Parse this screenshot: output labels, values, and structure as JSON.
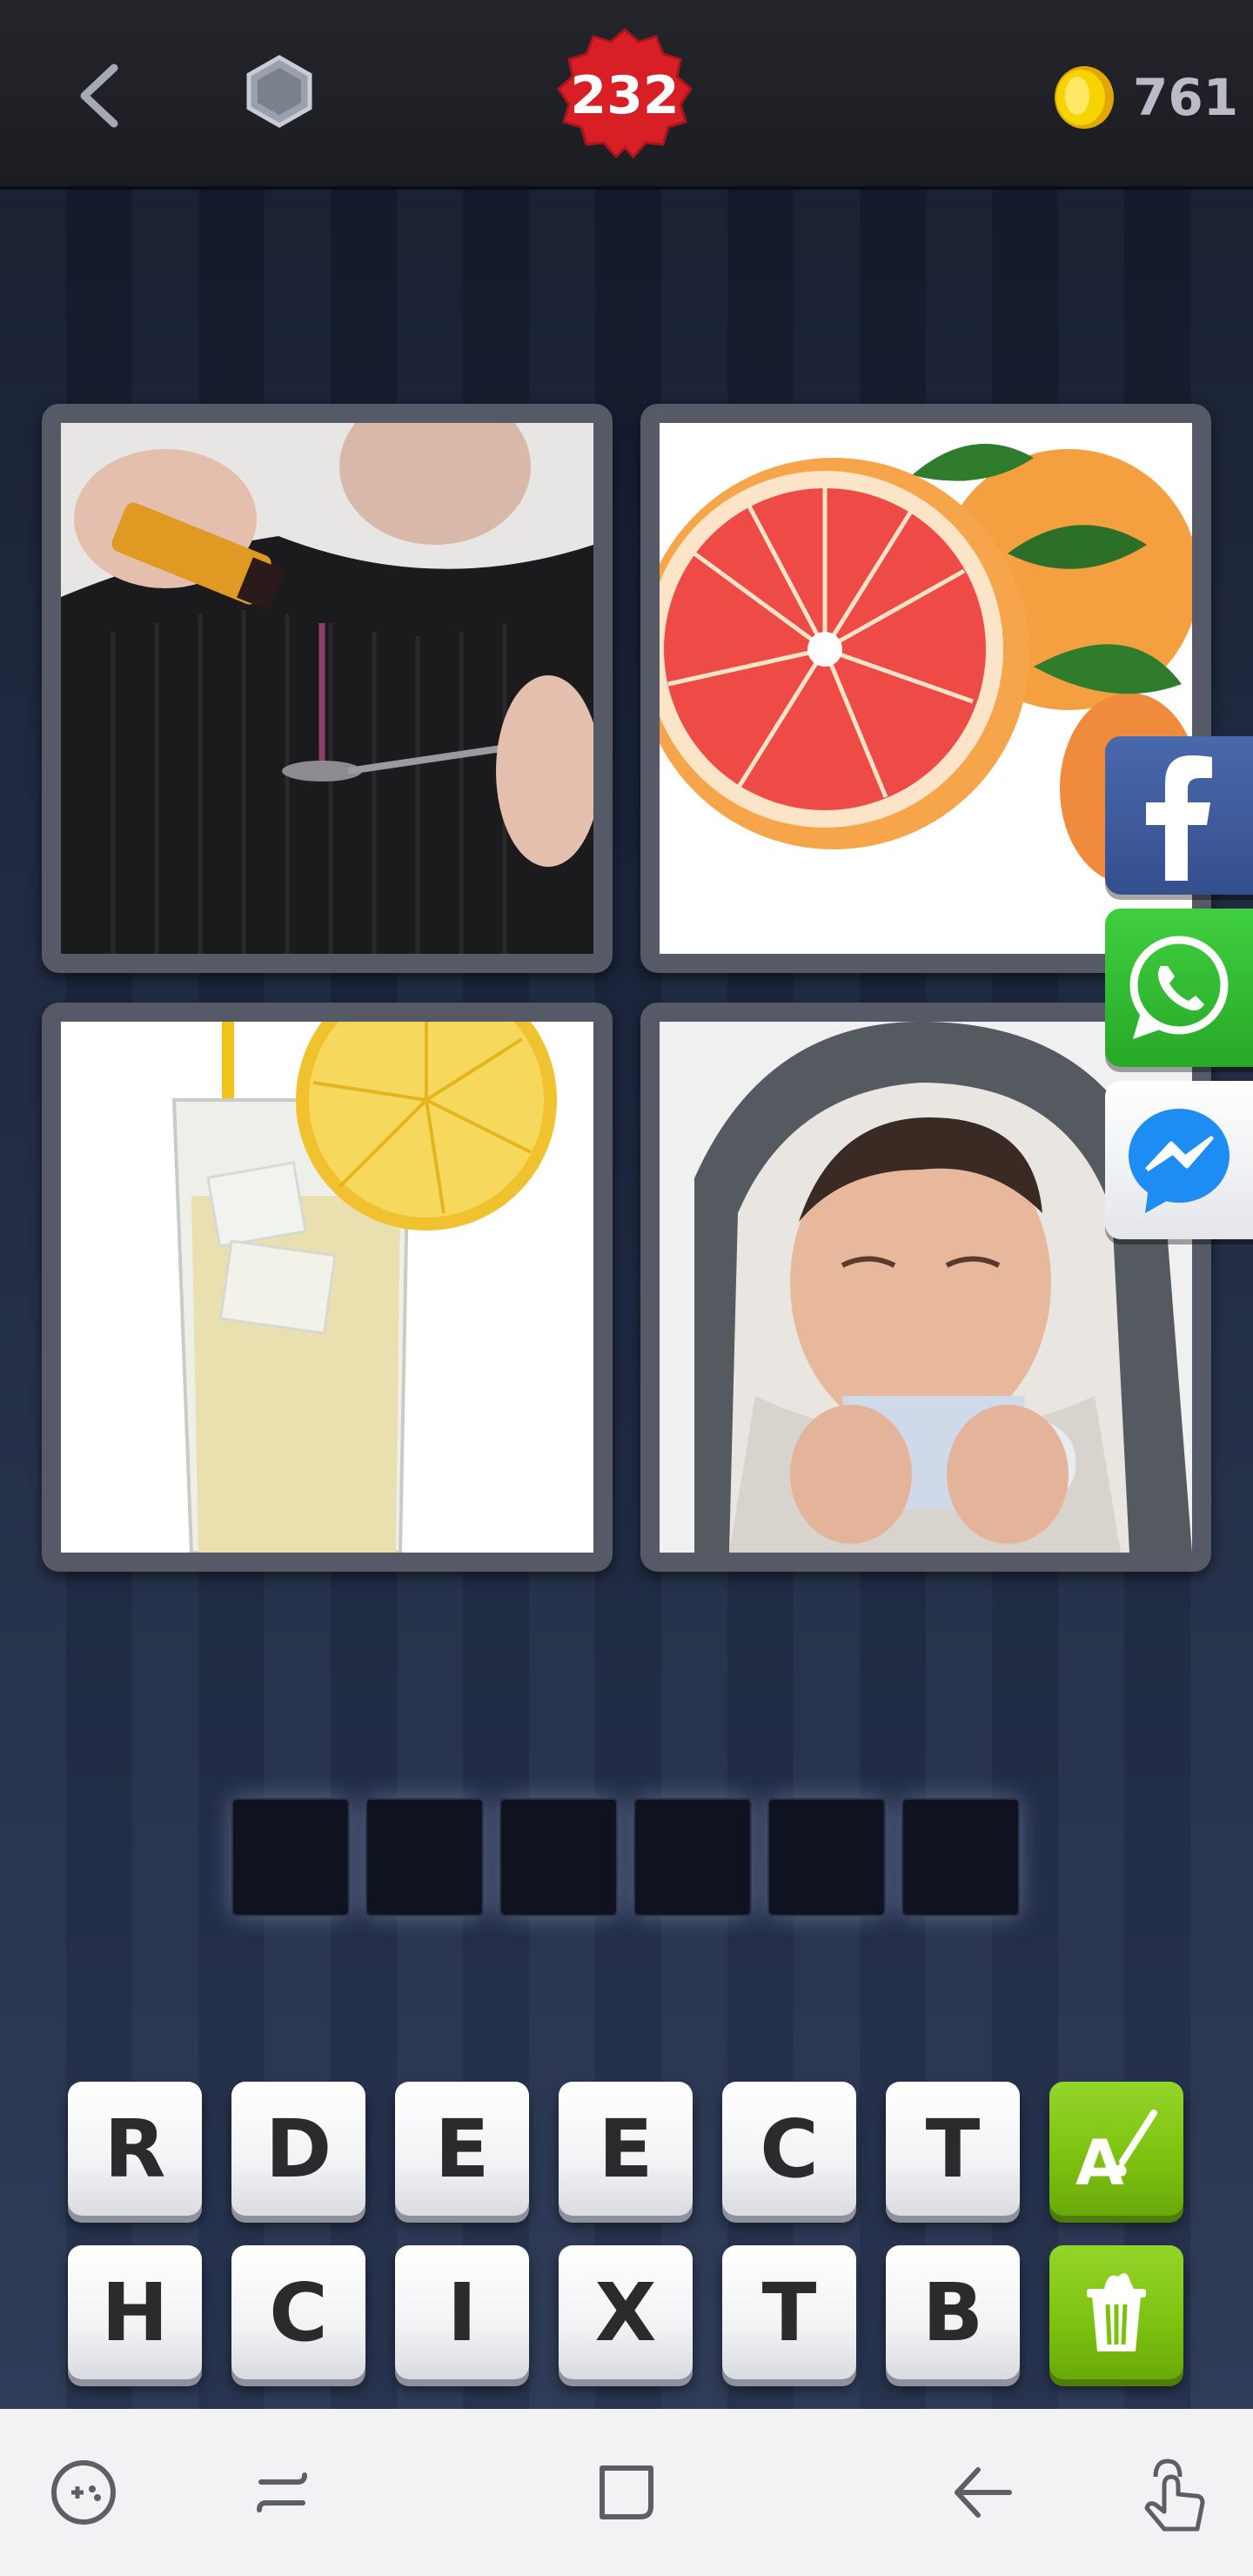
{
  "header": {
    "back_icon": "chevron-left-icon",
    "hint_icon": "hexagon-gem-icon",
    "level": "232",
    "level_badge_color": "#d81f26",
    "coins": "761",
    "coin_color": "#f2c200"
  },
  "pictures": [
    {
      "name": "man-pouring-syrup-on-spoon"
    },
    {
      "name": "grapefruit-halves"
    },
    {
      "name": "lemonade-glass-with-lemon-slice"
    },
    {
      "name": "woman-in-hood-drinking-from-mug"
    }
  ],
  "share": {
    "facebook_color": "#3b5998",
    "whatsapp_color": "#2fbd2f",
    "messenger_color": "#ffffff"
  },
  "answer": {
    "slots": [
      "",
      "",
      "",
      "",
      "",
      ""
    ]
  },
  "letters": {
    "row1": [
      "R",
      "D",
      "E",
      "E",
      "C",
      "T"
    ],
    "row2": [
      "H",
      "C",
      "I",
      "X",
      "T",
      "B"
    ]
  },
  "hint_buttons": {
    "reveal_icon": "reveal-letter-brush-icon",
    "remove_icon": "remove-letters-trash-icon",
    "color": "#7cc10f"
  },
  "system_nav": [
    "game-launcher-icon",
    "recents-icon",
    "home-icon",
    "back-icon",
    "assistant-touch-icon"
  ]
}
